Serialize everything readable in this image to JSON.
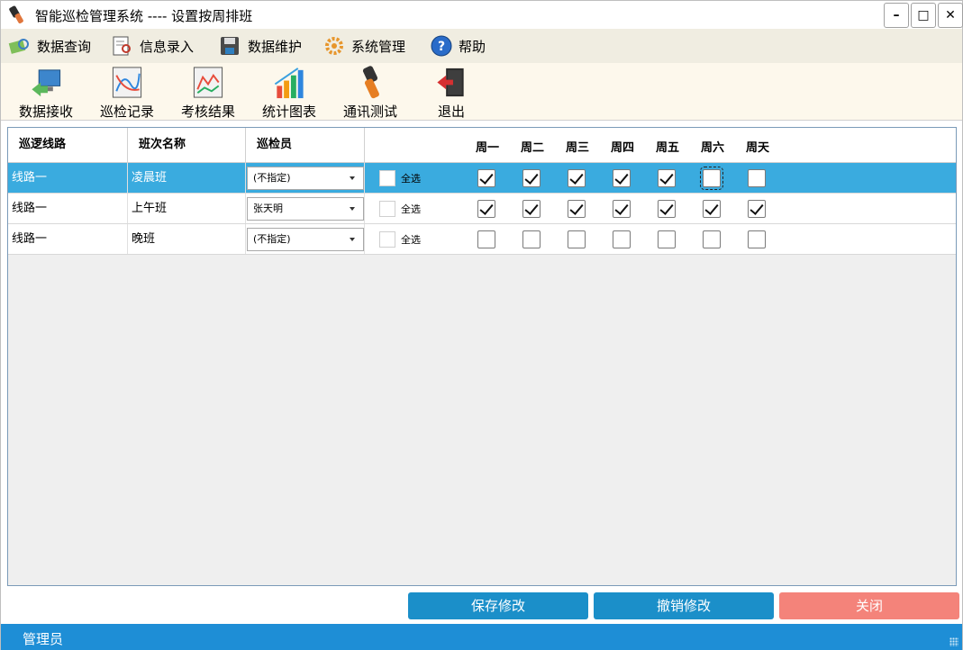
{
  "window": {
    "title": "智能巡检管理系统 ---- 设置按周排班",
    "min_label": "–",
    "max_label": "□",
    "close_label": "✕"
  },
  "menu": [
    {
      "label": "数据查询",
      "icon": "data-query-icon"
    },
    {
      "label": "信息录入",
      "icon": "info-entry-icon"
    },
    {
      "label": "数据维护",
      "icon": "data-maintenance-icon"
    },
    {
      "label": "系统管理",
      "icon": "system-settings-icon"
    },
    {
      "label": "帮助",
      "icon": "help-icon"
    }
  ],
  "toolbar": [
    {
      "label": "数据接收",
      "icon": "data-receive-icon"
    },
    {
      "label": "巡检记录",
      "icon": "patrol-record-icon"
    },
    {
      "label": "考核结果",
      "icon": "assessment-icon"
    },
    {
      "label": "统计图表",
      "icon": "bar-chart-icon"
    },
    {
      "label": "通讯测试",
      "icon": "device-test-icon"
    },
    {
      "label": "退出",
      "icon": "exit-icon"
    }
  ],
  "grid": {
    "headers": {
      "route": "巡逻线路",
      "shift": "班次名称",
      "inspector": "巡检员",
      "days": [
        "周一",
        "周二",
        "周三",
        "周四",
        "周五",
        "周六",
        "周天"
      ]
    },
    "select_all_label": "全选",
    "rows": [
      {
        "route": "线路一",
        "shift": "凌晨班",
        "inspector": "(不指定)",
        "days": [
          true,
          true,
          true,
          true,
          true,
          false,
          false
        ],
        "selected": true
      },
      {
        "route": "线路一",
        "shift": "上午班",
        "inspector": "张天明",
        "days": [
          true,
          true,
          true,
          true,
          true,
          true,
          true
        ],
        "selected": false
      },
      {
        "route": "线路一",
        "shift": "晚班",
        "inspector": "(不指定)",
        "days": [
          false,
          false,
          false,
          false,
          false,
          false,
          false
        ],
        "selected": false
      }
    ]
  },
  "buttons": {
    "save": "保存修改",
    "undo": "撤销修改",
    "close": "关闭"
  },
  "status": {
    "user": "管理员"
  },
  "colors": {
    "selected_row": "#3aabdf",
    "primary_button": "#1b8fc9",
    "close_button": "#f4837a",
    "statusbar": "#1e8ed6"
  }
}
